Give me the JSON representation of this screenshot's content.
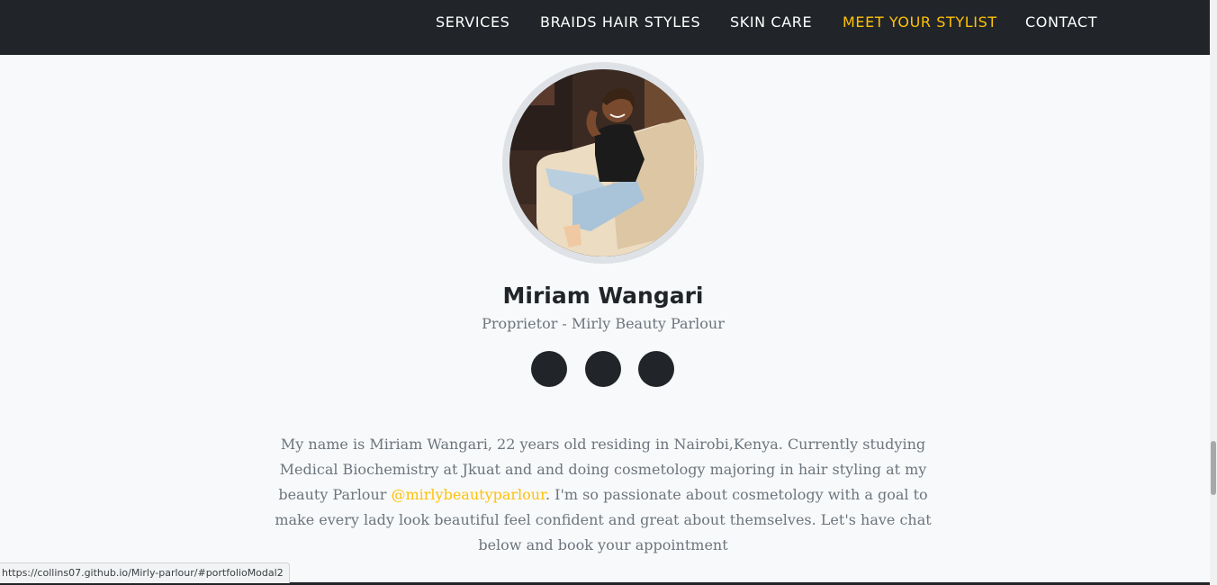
{
  "nav": {
    "items": [
      {
        "label": "SERVICES"
      },
      {
        "label": "BRAIDS HAIR STYLES"
      },
      {
        "label": "SKIN CARE"
      },
      {
        "label": "MEET YOUR STYLIST"
      },
      {
        "label": "CONTACT"
      }
    ],
    "active_index": 3
  },
  "profile": {
    "name": "Miriam Wangari",
    "role": "Proprietor - Mirly Beauty Parlour",
    "social_icons": [
      "social-icon-1",
      "social-icon-2",
      "social-icon-3"
    ]
  },
  "bio": {
    "part1": "My name is Miriam Wangari, 22 years old residing in Nairobi,Kenya. Currently studying Medical Biochemistry at Jkuat and and doing cosmetology majoring in hair styling at my beauty Parlour ",
    "handle": "@mirlybeautyparlour",
    "part2": ". I'm so passionate about cosmetology with a goal to make every lady look beautiful feel confident and great about themselves. Let's have chat below and book your appointment"
  },
  "status_bar": {
    "url": "https://collins07.github.io/Mirly-parlour/#portfolioModal2"
  },
  "colors": {
    "nav_bg": "#212529",
    "accent": "#ffc107",
    "page_bg": "#f8f9fa",
    "muted_text": "#6c757d"
  }
}
